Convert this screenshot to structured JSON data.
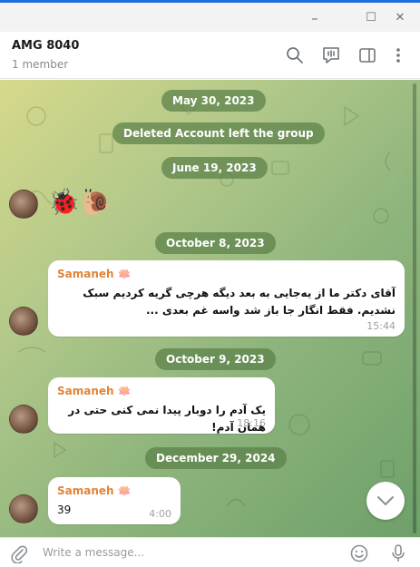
{
  "window": {
    "minimize": "–",
    "maximize": "☐",
    "close": "✕"
  },
  "header": {
    "title": "AMG 8040",
    "subtitle": "1 member",
    "icons": [
      "search-icon",
      "voice-chat-icon",
      "sidebar-toggle-icon",
      "more-icon"
    ]
  },
  "chat": {
    "dates": {
      "d1": "May 30, 2023",
      "d2": "June 19, 2023",
      "d3": "October 8, 2023",
      "d4": "October 9, 2023",
      "d5": "December 29, 2024"
    },
    "service": "Deleted Account left the group",
    "sticker_message": "🐞🐌",
    "messages": [
      {
        "sender": "Samaneh 🪷",
        "text": "آقای دکتر ما از یه‌جایی به بعد دیگه هرچی گریه کردیم سبک نشدیم. فقط انگار جا باز شد واسه غم بعدی ...",
        "time": "15:44"
      },
      {
        "sender": "Samaneh 🪷",
        "text": "یک آدم را دوبار پیدا نمی کنی حتی در همان آدم!",
        "time": "18:16"
      },
      {
        "sender": "Samaneh 🪷",
        "text": "39",
        "time": "4:00"
      }
    ]
  },
  "composer": {
    "placeholder": "Write a message..."
  },
  "colors": {
    "sender": "#e0843a",
    "pill": "#5a8048",
    "accent": "#1e6fd9"
  }
}
